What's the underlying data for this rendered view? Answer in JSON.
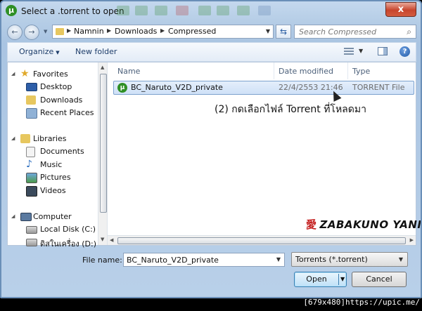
{
  "window": {
    "title": "Select a .torrent to open",
    "close_glyph": "x"
  },
  "navigation": {
    "back_glyph": "←",
    "forward_glyph": "→",
    "breadcrumb": [
      "Namnin",
      "Downloads",
      "Compressed"
    ],
    "search_placeholder": "Search Compressed"
  },
  "toolbar": {
    "organize_label": "Organize",
    "new_folder_label": "New folder",
    "help_glyph": "?"
  },
  "sidebar": {
    "favorites": {
      "label": "Favorites",
      "items": [
        "Desktop",
        "Downloads",
        "Recent Places"
      ]
    },
    "libraries": {
      "label": "Libraries",
      "items": [
        "Documents",
        "Music",
        "Pictures",
        "Videos"
      ]
    },
    "computer": {
      "label": "Computer",
      "items": [
        "Local Disk (C:)",
        "ดิสในเครื่อง (D:)"
      ]
    }
  },
  "columns": {
    "name": "Name",
    "date_modified": "Date modified",
    "type": "Type"
  },
  "files": [
    {
      "name": "BC_Naruto_V2D_private",
      "date": "22/4/2553 21:46",
      "type": "TORRENT File"
    }
  ],
  "annotation": "(2) กดเลือกไฟล์ Torrent ที่โหลดมา",
  "watermark": {
    "kanji": "愛",
    "text": "ZABAKUNO YANIN"
  },
  "file_name": {
    "label": "File name:",
    "value": "BC_Naruto_V2D_private"
  },
  "file_type": {
    "value": "Torrents (*.torrent)"
  },
  "buttons": {
    "open": "Open",
    "cancel": "Cancel"
  },
  "footer": "[679x480]https://upic.me/",
  "colors": {
    "selection": "#cfe1f7",
    "chrome": "#b5cde6",
    "close": "#c7452d"
  }
}
